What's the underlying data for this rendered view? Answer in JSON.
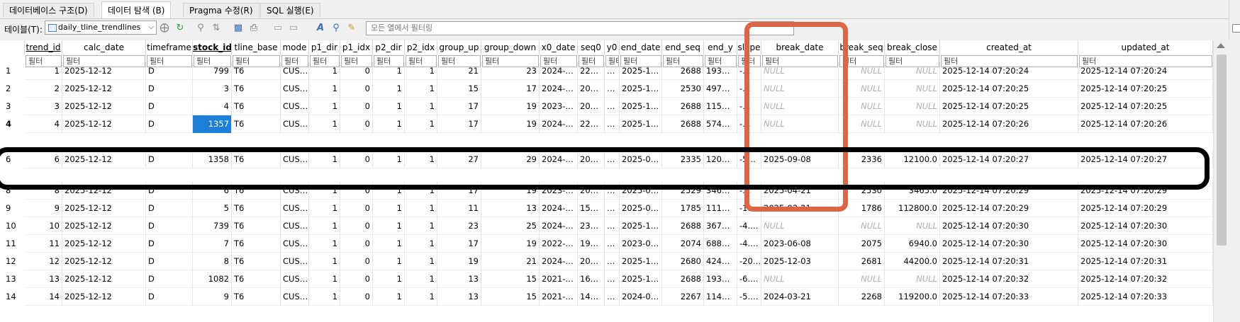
{
  "tabs": [
    {
      "label": "데이터베이스 구조(D)"
    },
    {
      "label": "데이터 탐색 (B)"
    },
    {
      "label": "Pragma 수정(R)"
    },
    {
      "label": "SQL 실행(E)"
    }
  ],
  "toolbar": {
    "table_label": "테이블(T):",
    "table_select": "daily_tline_trendlines",
    "filter_placeholder": "모든 열에서 필터링"
  },
  "grid": {
    "columns": [
      "trend_id",
      "calc_date",
      "timeframe",
      "stock_id",
      "tline_base",
      "mode",
      "p1_dir",
      "p1_idx",
      "p2_dir",
      "p2_idx",
      "group_up",
      "group_down",
      "x0_date",
      "seq0",
      "y0",
      "end_date",
      "end_seq",
      "end_y",
      "slope",
      "break_date",
      "break_seq",
      "break_close",
      "created_at",
      "updated_at"
    ],
    "filter_placeholder": "필터",
    "null_text": "NULL",
    "rows": [
      {
        "num": "1",
        "cells": [
          "1",
          "2025-12-12",
          "D",
          "799",
          "T6",
          "CUS…",
          "1",
          "0",
          "1",
          "1",
          "21",
          "23",
          "2024-…",
          "22…",
          "…",
          "2025-1…",
          "2688",
          "193…",
          "-…",
          "NULL",
          "NULL",
          "NULL",
          "2025-12-14 07:20:24",
          "2025-12-14 07:20:24"
        ]
      },
      {
        "num": "2",
        "cells": [
          "2",
          "2025-12-12",
          "D",
          "3",
          "T6",
          "CUS…",
          "1",
          "0",
          "1",
          "1",
          "15",
          "17",
          "2024-…",
          "20…",
          "…",
          "2025-1…",
          "2530",
          "497…",
          "-…",
          "NULL",
          "NULL",
          "NULL",
          "2025-12-14 07:20:25",
          "2025-12-14 07:20:25"
        ]
      },
      {
        "num": "3",
        "cells": [
          "3",
          "2025-12-12",
          "D",
          "4",
          "T6",
          "CUS…",
          "1",
          "0",
          "1",
          "1",
          "17",
          "19",
          "2023-…",
          "20…",
          "…",
          "2025-1…",
          "2688",
          "115…",
          "-…",
          "NULL",
          "NULL",
          "NULL",
          "2025-12-14 07:20:25",
          "2025-12-14 07:20:25"
        ]
      },
      {
        "num": "4",
        "cells": [
          "4",
          "2025-12-12",
          "D",
          "1357",
          "T6",
          "CUS…",
          "1",
          "0",
          "1",
          "1",
          "17",
          "19",
          "2024-…",
          "22…",
          "…",
          "2025-1…",
          "2688",
          "574…",
          "-…",
          "NULL",
          "NULL",
          "NULL",
          "2025-12-14 07:20:26",
          "2025-12-14 07:20:26"
        ]
      },
      {
        "num": "6",
        "cells": [
          "6",
          "2025-12-12",
          "D",
          "1358",
          "T6",
          "CUS…",
          "1",
          "0",
          "1",
          "1",
          "27",
          "29",
          "2024-…",
          "20…",
          "…",
          "2025-0…",
          "2335",
          "120…",
          "-5…",
          "2025-09-08",
          "2336",
          "12100.0",
          "2025-12-14 07:20:27",
          "2025-12-14 07:20:27"
        ]
      },
      {
        "num": "8",
        "cells": [
          "8",
          "2025-12-12",
          "D",
          "6",
          "T6",
          "CUS…",
          "1",
          "0",
          "1",
          "1",
          "17",
          "19",
          "2023-…",
          "20…",
          "…",
          "2025-0…",
          "2529",
          "346…",
          "-…",
          "2025-04-21",
          "2530",
          "3465.0",
          "2025-12-14 07:20:29",
          "2025-12-14 07:20:29"
        ]
      },
      {
        "num": "9",
        "cells": [
          "9",
          "2025-12-12",
          "D",
          "5",
          "T6",
          "CUS…",
          "1",
          "0",
          "1",
          "1",
          "11",
          "13",
          "2024-…",
          "15…",
          "…",
          "2025-0…",
          "1785",
          "111…",
          "-1…",
          "2025-03-21",
          "1786",
          "112800.0",
          "2025-12-14 07:20:29",
          "2025-12-14 07:20:29"
        ]
      },
      {
        "num": "10",
        "cells": [
          "10",
          "2025-12-12",
          "D",
          "739",
          "T6",
          "CUS…",
          "1",
          "0",
          "1",
          "1",
          "23",
          "25",
          "2024-…",
          "23…",
          "…",
          "2025-1…",
          "2688",
          "367…",
          "-4.…",
          "NULL",
          "NULL",
          "NULL",
          "2025-12-14 07:20:30",
          "2025-12-14 07:20:30"
        ]
      },
      {
        "num": "11",
        "cells": [
          "11",
          "2025-12-12",
          "D",
          "7",
          "T6",
          "CUS…",
          "1",
          "0",
          "1",
          "1",
          "17",
          "19",
          "2022-…",
          "19…",
          "…",
          "2023-0…",
          "2074",
          "688…",
          "-4.…",
          "2023-06-08",
          "2075",
          "6940.0",
          "2025-12-14 07:20:30",
          "2025-12-14 07:20:30"
        ]
      },
      {
        "num": "12",
        "cells": [
          "12",
          "2025-12-12",
          "D",
          "8",
          "T6",
          "CUS…",
          "1",
          "0",
          "1",
          "1",
          "19",
          "21",
          "2024-…",
          "20…",
          "…",
          "2025-1…",
          "2680",
          "424…",
          "-20…",
          "2025-12-03",
          "2681",
          "44200.0",
          "2025-12-14 07:20:31",
          "2025-12-14 07:20:31"
        ]
      },
      {
        "num": "13",
        "cells": [
          "13",
          "2025-12-12",
          "D",
          "1082",
          "T6",
          "CUS…",
          "1",
          "0",
          "1",
          "1",
          "13",
          "15",
          "2021-…",
          "16…",
          "…",
          "2025-1…",
          "2688",
          "193…",
          "-6.…",
          "NULL",
          "NULL",
          "NULL",
          "2025-12-14 07:20:32",
          "2025-12-14 07:20:32"
        ]
      },
      {
        "num": "14",
        "cells": [
          "14",
          "2025-12-12",
          "D",
          "9",
          "T6",
          "CUS…",
          "1",
          "0",
          "1",
          "1",
          "13",
          "15",
          "2021-…",
          "14…",
          "…",
          "2024-0…",
          "2267",
          "114…",
          "-5.…",
          "2024-03-21",
          "2268",
          "119200.0",
          "2025-12-14 07:20:33",
          "2025-12-14 07:20:33"
        ]
      }
    ]
  },
  "colors": {
    "annotation_orange": "#de6445",
    "annotation_black": "#000000",
    "selection_blue": "#1e7fd8"
  }
}
